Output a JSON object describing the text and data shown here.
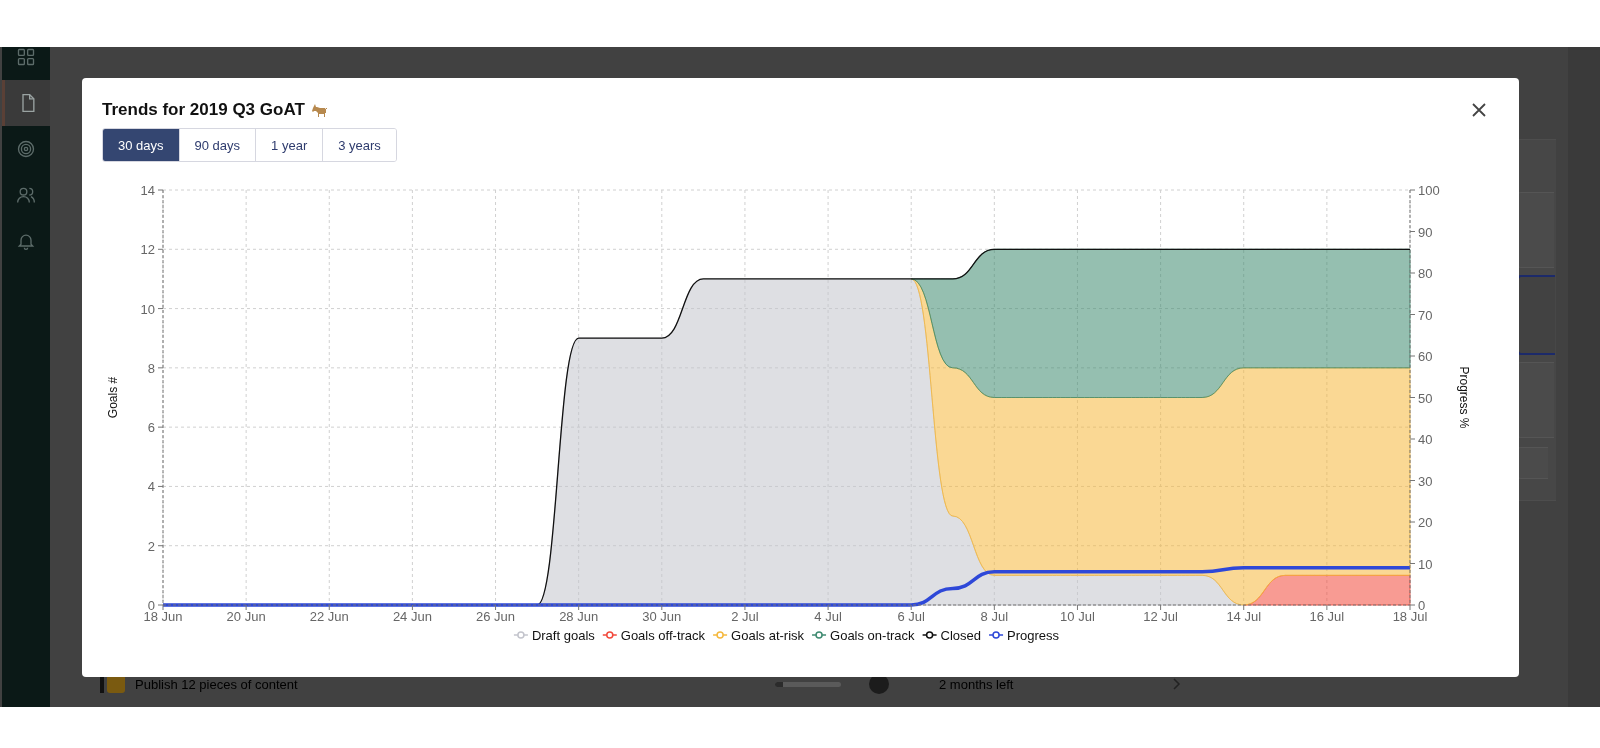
{
  "sidebar": {
    "items": [
      {
        "selected": false
      },
      {
        "selected": true
      },
      {
        "selected": false
      },
      {
        "selected": false
      },
      {
        "selected": false
      }
    ]
  },
  "background": {
    "goal_row": {
      "title": "Publish 12 pieces of content",
      "level": 0.12,
      "time_left": "2 months left"
    }
  },
  "modal": {
    "title": "Trends for 2019 Q3 GoAT",
    "tabs": [
      {
        "label": "30 days",
        "selected": true
      },
      {
        "label": "90 days",
        "selected": false
      },
      {
        "label": "1 year",
        "selected": false
      },
      {
        "label": "3 years",
        "selected": false
      }
    ],
    "chart_data": {
      "type": "area",
      "stacked": true,
      "grid": true,
      "legend": true,
      "ylabel": "Goals #",
      "y2label": "Progress %",
      "categories": [
        "18 Jun",
        null,
        "20 Jun",
        null,
        "22 Jun",
        null,
        "24 Jun",
        null,
        "26 Jun",
        null,
        "28 Jun",
        null,
        "30 Jun",
        null,
        "2 Jul",
        null,
        "4 Jul",
        null,
        "6 Jul",
        null,
        "8 Jul",
        null,
        "10 Jul",
        null,
        "12 Jul",
        null,
        "14 Jul",
        null,
        "16 Jul",
        null,
        "18 Jul"
      ],
      "ylim": [
        0,
        14
      ],
      "y2lim": [
        0,
        100
      ],
      "yticks": [
        0,
        2,
        4,
        6,
        8,
        10,
        12,
        14
      ],
      "y2ticks": [
        0,
        10,
        20,
        30,
        40,
        50,
        60,
        70,
        80,
        90,
        100
      ],
      "series": [
        {
          "name": "Draft goals",
          "color": "#c3c4cc",
          "values": [
            null,
            null,
            null,
            null,
            null,
            null,
            null,
            null,
            null,
            0,
            9,
            9,
            9,
            11,
            11,
            11,
            11,
            11,
            11,
            3,
            1,
            1,
            1,
            1,
            1,
            1,
            0,
            null,
            null,
            null,
            null
          ]
        },
        {
          "name": "Goals off-track",
          "color": "#f2493b",
          "values": [
            null,
            null,
            null,
            null,
            null,
            null,
            null,
            null,
            null,
            null,
            null,
            null,
            null,
            null,
            null,
            null,
            null,
            null,
            null,
            null,
            null,
            null,
            null,
            null,
            null,
            null,
            0,
            1,
            1,
            1,
            1
          ]
        },
        {
          "name": "Goals at-risk",
          "color": "#f5b83d",
          "values": [
            null,
            null,
            null,
            null,
            null,
            null,
            null,
            null,
            null,
            null,
            null,
            null,
            null,
            null,
            null,
            null,
            null,
            null,
            0,
            5,
            6,
            6,
            6,
            6,
            6,
            6,
            8,
            7,
            7,
            7,
            7
          ]
        },
        {
          "name": "Goals on-track",
          "color": "#3e8a70",
          "values": [
            null,
            null,
            null,
            null,
            null,
            null,
            null,
            null,
            null,
            null,
            null,
            null,
            null,
            null,
            null,
            null,
            null,
            null,
            0,
            3,
            5,
            5,
            5,
            5,
            5,
            5,
            4,
            4,
            4,
            4,
            4
          ]
        },
        {
          "name": "Closed",
          "type": "line",
          "color": "#111111",
          "values": [
            0,
            0,
            0,
            0,
            0,
            0,
            0,
            0,
            0,
            0,
            9,
            9,
            9,
            11,
            11,
            11,
            11,
            11,
            11,
            11,
            12,
            12,
            12,
            12,
            12,
            12,
            12,
            12,
            12,
            12,
            12
          ]
        },
        {
          "name": "Progress",
          "type": "line",
          "color": "#2e48d8",
          "axis": "y2",
          "values": [
            0,
            0,
            0,
            0,
            0,
            0,
            0,
            0,
            0,
            0,
            0,
            0,
            0,
            0,
            0,
            0,
            0,
            0,
            0,
            4,
            8,
            8,
            8,
            8,
            8,
            8,
            9,
            9,
            9,
            9,
            9
          ]
        }
      ]
    }
  }
}
